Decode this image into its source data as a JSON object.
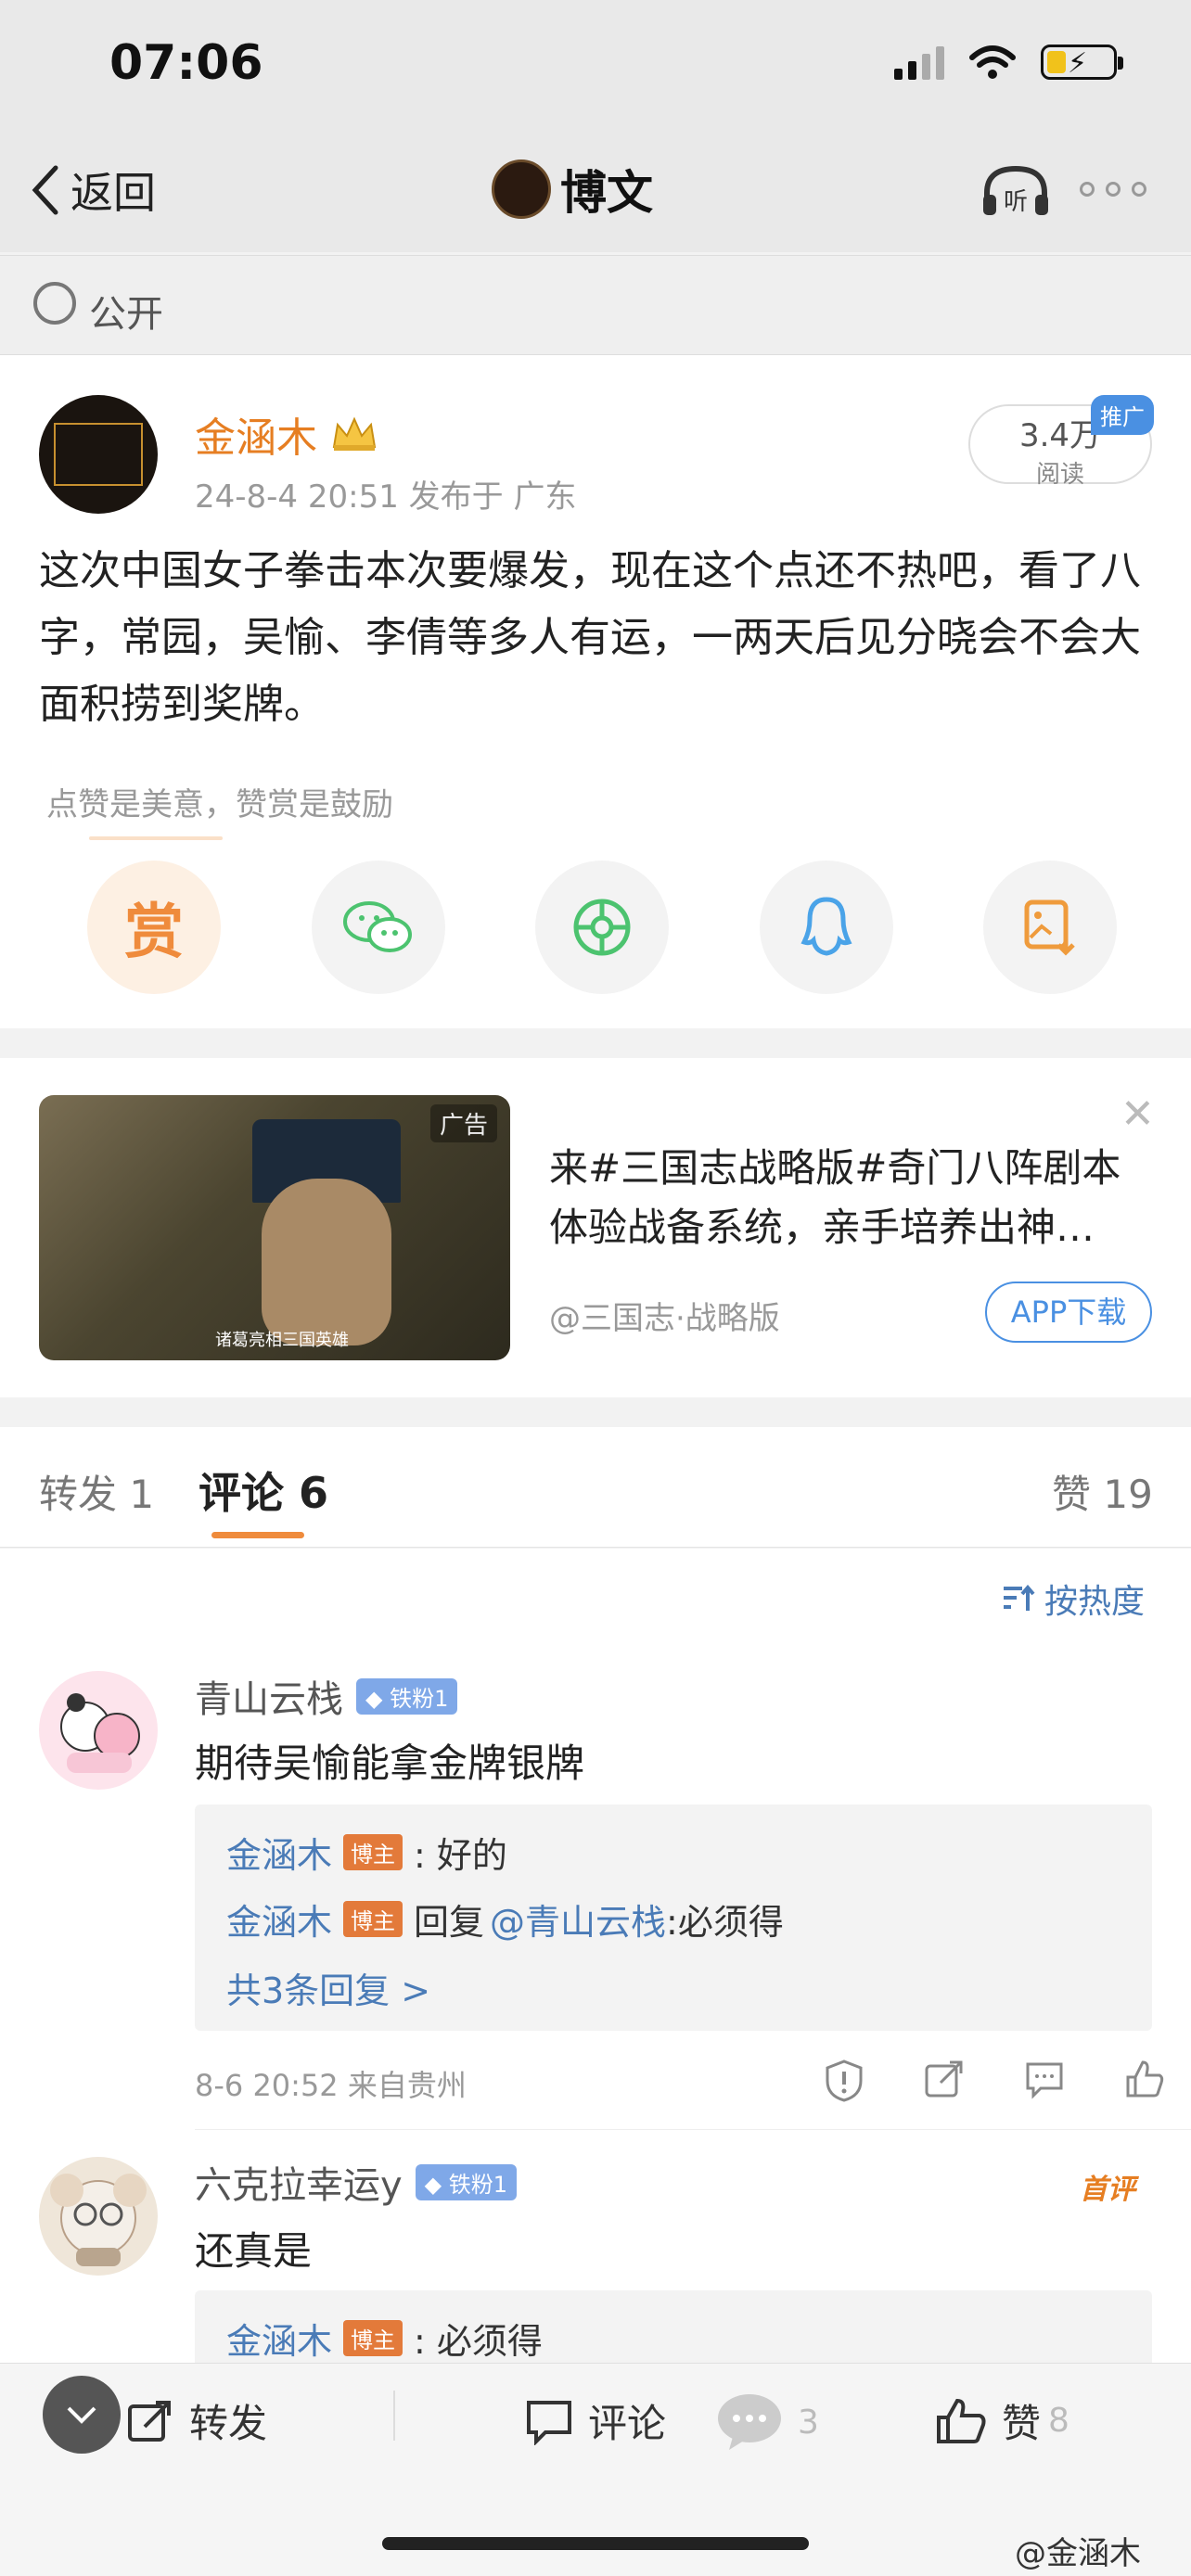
{
  "status_bar": {
    "time": "07:06"
  },
  "nav": {
    "back_label": "返回",
    "title": "博文",
    "listen_label": "听"
  },
  "visibility": {
    "label": "公开"
  },
  "post": {
    "author": "金涵木",
    "meta": "24-8-4 20:51  发布于 广东",
    "reads_value": "3.4万",
    "reads_label": "阅读",
    "promo_tag": "推广",
    "text": "这次中国女子拳击本次要爆发，现在这个点还不热吧，看了八字，常园，吴愉、李倩等多人有运，一两天后见分晓会不会大面积捞到奖牌。",
    "reward_tip": "点赞是美意，赞赏是鼓励",
    "reward_char": "赏"
  },
  "ad": {
    "tag": "广告",
    "subtitle": "诸葛亮相三国英雄",
    "text": "来#三国志战略版#奇门八阵剧本体验战备系统，亲手培养出神…",
    "source": "@三国志·战略版",
    "download_label": "APP下载"
  },
  "tabs": {
    "forward": "转发 1",
    "comment": "评论 6",
    "like": "赞 19"
  },
  "sort_label": "按热度",
  "comments": [
    {
      "user": "青山云栈",
      "badge": "铁粉1",
      "text": "期待吴愉能拿金牌银牌",
      "replies": [
        {
          "user": "金涵木",
          "badge": "博主",
          "text": ": 好的"
        },
        {
          "user": "金涵木",
          "badge": "博主",
          "prefix": "回复",
          "mention": "@青山云栈",
          "text": ":必须得"
        }
      ],
      "more_replies": "共3条回复 >",
      "meta": "8-6 20:52  来自贵州"
    },
    {
      "user": "六克拉幸运y",
      "badge": "铁粉1",
      "first_tag": "首评",
      "text": "还真是",
      "replies": [
        {
          "user": "金涵木",
          "badge": "博主",
          "text": ": 必须得"
        }
      ]
    }
  ],
  "bottom_bar": {
    "forward_label": "转发",
    "comment_label": "评论",
    "comment_count": "3",
    "like_label": "赞",
    "like_count": "8"
  },
  "watermark": "@金涵木"
}
